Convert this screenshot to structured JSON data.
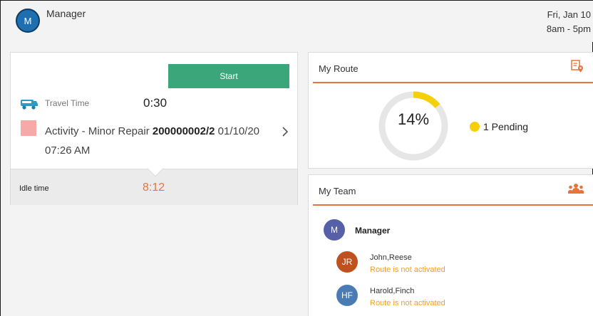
{
  "header": {
    "avatar_initial": "M",
    "role": "Manager",
    "date": "Fri, Jan 10",
    "hours": "8am - 5pm"
  },
  "activity_card": {
    "start_label": "Start",
    "travel_label": "Travel Time",
    "travel_value": "0:30",
    "activity_name": "Activity - Minor Repair",
    "activity_id": "200000002/2",
    "activity_date": "01/10/20",
    "activity_time": "07:26 AM",
    "idle_label": "Idle time",
    "idle_value": "8:12"
  },
  "route_card": {
    "title": "My Route",
    "percent_label": "14%",
    "percent": 14,
    "pending_label": "1 Pending",
    "colors": {
      "accent": "#e8743b",
      "progress": "#f5d00a",
      "track": "#e6e6e6"
    }
  },
  "team_card": {
    "title": "My Team",
    "manager": {
      "initial": "M",
      "name": "Manager",
      "color": "#5560a8"
    },
    "members": [
      {
        "initials": "JR",
        "name": "John,Reese",
        "status": "Route is not activated",
        "color": "#c0501e"
      },
      {
        "initials": "HF",
        "name": "Harold,Finch",
        "status": "Route is not activated",
        "color": "#4a7bb5"
      }
    ]
  }
}
